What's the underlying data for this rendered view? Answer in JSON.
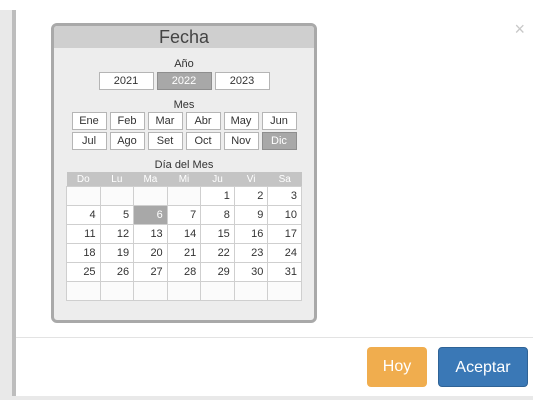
{
  "dialog": {
    "close_symbol": "×",
    "buttons": {
      "hoy": "Hoy",
      "aceptar": "Aceptar"
    },
    "colors": {
      "hoy": "#f0ad4e",
      "aceptar": "#3a78b6"
    }
  },
  "picker": {
    "title": "Fecha",
    "year_label": "Año",
    "years": [
      "2021",
      "2022",
      "2023"
    ],
    "selected_year": "2022",
    "month_label": "Mes",
    "months": [
      "Ene",
      "Feb",
      "Mar",
      "Abr",
      "May",
      "Jun",
      "Jul",
      "Ago",
      "Set",
      "Oct",
      "Nov",
      "Dic"
    ],
    "selected_month": "Dic",
    "day_label": "Día del Mes",
    "weekdays": [
      "Do",
      "Lu",
      "Ma",
      "Mi",
      "Ju",
      "Vi",
      "Sa"
    ],
    "weeks": [
      [
        "",
        "",
        "",
        "",
        "1",
        "2",
        "3"
      ],
      [
        "4",
        "5",
        "6",
        "7",
        "8",
        "9",
        "10"
      ],
      [
        "11",
        "12",
        "13",
        "14",
        "15",
        "16",
        "17"
      ],
      [
        "18",
        "19",
        "20",
        "21",
        "22",
        "23",
        "24"
      ],
      [
        "25",
        "26",
        "27",
        "28",
        "29",
        "30",
        "31"
      ],
      [
        "",
        "",
        "",
        "",
        "",
        "",
        ""
      ]
    ],
    "selected_day": "6"
  }
}
